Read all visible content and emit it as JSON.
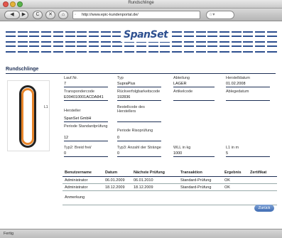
{
  "window": {
    "title": "Rundschlinge"
  },
  "toolbar": {
    "back_glyph": "◀",
    "forward_glyph": "▶",
    "reload_glyph": "C",
    "stop_glyph": "✕",
    "home_glyph": "⌂",
    "url": "http://www.epic-kundenportal.de/",
    "search_glyph": "☆▾"
  },
  "header": {
    "logo": "SpanSet"
  },
  "page": {
    "section_title": "Rundschlinge",
    "image_dim_label": "L1"
  },
  "fields": {
    "lauf_nr": {
      "label": "Lauf.Nr.",
      "value": "7"
    },
    "typ": {
      "label": "Typ",
      "value": "SupraPlus"
    },
    "abteilung": {
      "label": "Abteilung",
      "value": "LAGER"
    },
    "herstelldatum": {
      "label": "Herstelldatum",
      "value": "01.02.2008"
    },
    "transpondercode": {
      "label": "Transpondercode",
      "value": "E004010001ACDA841"
    },
    "rueckverfolgbarkeitscode": {
      "label": "Rückverfolgbarkeitscode",
      "value": "192836"
    },
    "artikelcode": {
      "label": "Artikelcode",
      "value": ""
    },
    "ablegedatum": {
      "label": "Ablegedatum",
      "value": ""
    },
    "hersteller": {
      "label": "Hersteller",
      "value": "SpanSet GmbH"
    },
    "bestellcode": {
      "label": "Bestellcode des Herstellers",
      "value": ""
    },
    "periode_standard": {
      "label": "Periode Standardprüfung",
      "value": "12"
    },
    "periode_risiko": {
      "label": "Periode Risoprüfung",
      "value": "0"
    },
    "typ2": {
      "label": "Typ2: Breid frei/",
      "value": "0"
    },
    "typ3": {
      "label": "Typ3: Anzahl der Stränge",
      "value": "0"
    },
    "wll": {
      "label": "WLL in kg",
      "value": "1000"
    },
    "l1": {
      "label": "L1 in m",
      "value": "5"
    }
  },
  "table": {
    "headers": [
      "Benutzername",
      "Datum",
      "Nächste Prüfung",
      "Transaktion",
      "Ergebnis",
      "Zertifikat"
    ],
    "rows": [
      [
        "Administrator",
        "06.01.2009",
        "06.01.2010",
        "Standard-Prüfung",
        "OK",
        ""
      ],
      [
        "Administrator",
        "18.12.2009",
        "18.12.2009",
        "Standard-Prüfung",
        "OK",
        ""
      ]
    ]
  },
  "anmerkung": {
    "label": "Anmerkung"
  },
  "buttons": {
    "back": "Zurück"
  },
  "status": {
    "text": "Fertig"
  },
  "colors": {
    "brand": "#2d4f8f",
    "accent_orange": "#e8852a"
  }
}
